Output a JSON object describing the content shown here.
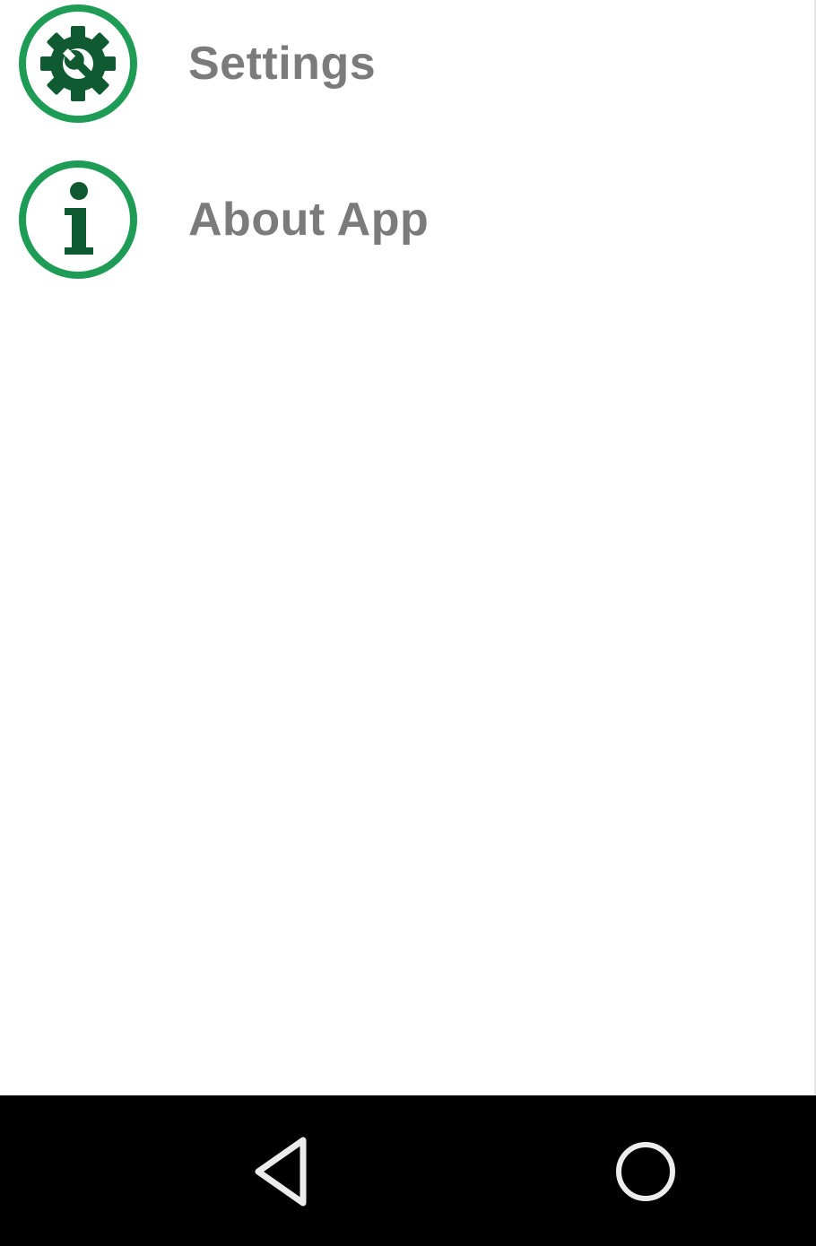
{
  "menu": {
    "items": [
      {
        "label": "Settings",
        "icon": "settings-gear-wrench-icon"
      },
      {
        "label": "About App",
        "icon": "info-icon"
      }
    ]
  },
  "nav_bar": {
    "back_icon": "back-triangle-icon",
    "home_icon": "home-circle-icon"
  },
  "colors": {
    "ring_green": "#1e9b55",
    "icon_dark_green": "#0f5a30",
    "label_gray": "#7b7b7b",
    "nav_bar": "#000000"
  }
}
